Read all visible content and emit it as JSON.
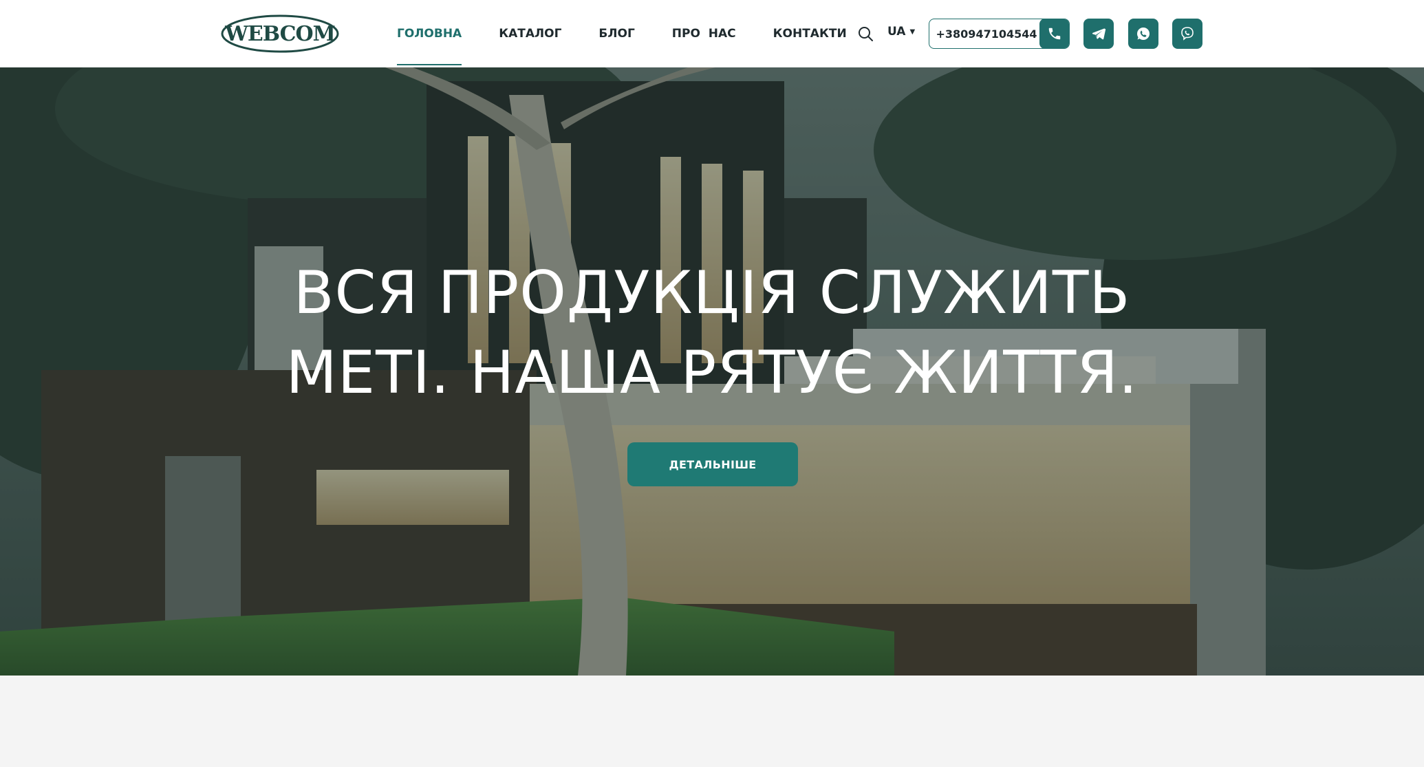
{
  "header": {
    "logo_text": "WEBCOM",
    "nav": [
      {
        "label": "ГОЛОВНА",
        "active": true
      },
      {
        "label": "КАТАЛОГ",
        "active": false
      },
      {
        "label": "БЛОГ",
        "active": false
      },
      {
        "label": "ПРО  НАС",
        "active": false
      },
      {
        "label": "КОНТАКТИ",
        "active": false
      }
    ],
    "search_icon": "search-icon",
    "language": "UA",
    "phone": "+380947104544",
    "social_icons": [
      "phone-icon",
      "telegram-icon",
      "whatsapp-icon",
      "viber-icon"
    ]
  },
  "hero": {
    "title_line1": "ВСЯ ПРОДУКЦІЯ СЛУЖИТЬ",
    "title_line2": "МЕТІ. НАША РЯТУЄ ЖИТТЯ.",
    "cta_label": "ДЕТАЛЬНІШЕ"
  },
  "colors": {
    "accent": "#1f6f6c",
    "button": "#1f7a74",
    "text": "#1f2a2e",
    "footer_bg": "#f4f4f4"
  }
}
